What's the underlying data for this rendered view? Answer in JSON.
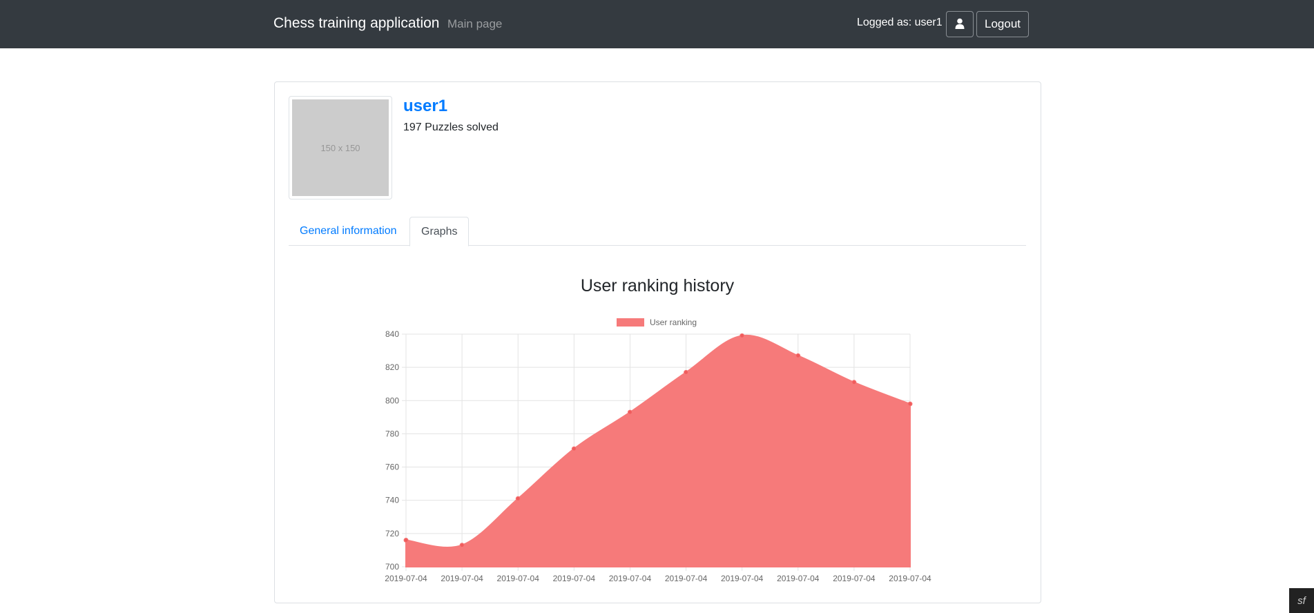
{
  "navbar": {
    "brand": "Chess training application",
    "main_link": "Main page",
    "logged_as": "Logged as: user1",
    "profile_icon": "user-icon",
    "logout_label": "Logout"
  },
  "profile": {
    "placeholder_text": "150 x 150",
    "username": "user1",
    "puzzles_solved": "197 Puzzles solved"
  },
  "tabs": [
    {
      "label": "General information",
      "active": false
    },
    {
      "label": "Graphs",
      "active": true
    }
  ],
  "chart_title": "User ranking history",
  "chart_data": {
    "type": "area",
    "title": "User ranking history",
    "categories": [
      "2019-07-04",
      "2019-07-04",
      "2019-07-04",
      "2019-07-04",
      "2019-07-04",
      "2019-07-04",
      "2019-07-04",
      "2019-07-04",
      "2019-07-04",
      "2019-07-04"
    ],
    "series": [
      {
        "name": "User ranking",
        "values": [
          716,
          713,
          741,
          771,
          793,
          817,
          839,
          827,
          811,
          798
        ],
        "color": "#f67a7a"
      }
    ],
    "ylim": [
      700,
      840
    ],
    "yticks": [
      700,
      720,
      740,
      760,
      780,
      800,
      820,
      840
    ],
    "grid": true,
    "legend": "top-center"
  },
  "footer": {
    "badge_icon": "symfony-icon",
    "badge_text": "sf"
  }
}
